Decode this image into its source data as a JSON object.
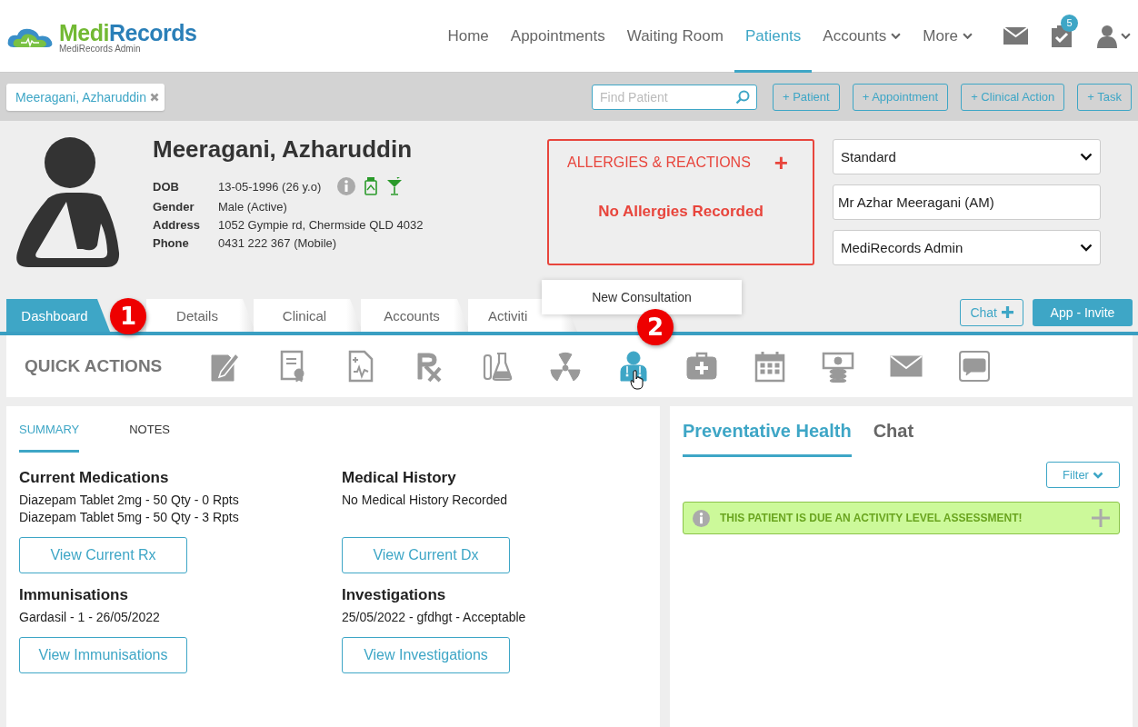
{
  "logo": {
    "first": "Medi",
    "second": "Records",
    "subtitle": "MediRecords Admin"
  },
  "nav": [
    {
      "label": "Home",
      "selected": false,
      "dropdown": false
    },
    {
      "label": "Appointments",
      "selected": false,
      "dropdown": false
    },
    {
      "label": "Waiting Room",
      "selected": false,
      "dropdown": false
    },
    {
      "label": "Patients",
      "selected": true,
      "dropdown": false
    },
    {
      "label": "Accounts",
      "selected": false,
      "dropdown": true
    },
    {
      "label": "More",
      "selected": false,
      "dropdown": true
    }
  ],
  "tasks_badge": "5",
  "toolbar": {
    "patient_chip": "Meeragani, Azharuddin",
    "search": {
      "placeholder": "Find Patient"
    },
    "buttons": [
      "+ Patient",
      "+ Appointment",
      "+ Clinical Action",
      "+ Task"
    ]
  },
  "patient": {
    "name": "Meeragani, Azharuddin",
    "fields": [
      {
        "label": "DOB",
        "value": "13-05-1996 (26 y.o)"
      },
      {
        "label": "Gender",
        "value": "Male (Active)"
      },
      {
        "label": "Address",
        "value": "1052 Gympie rd, Chermside QLD 4032"
      },
      {
        "label": "Phone",
        "value": "0431 222 367 (Mobile)"
      }
    ]
  },
  "allergies": {
    "title": "ALLERGIES & REACTIONS",
    "add": "+",
    "message": "No Allergies Recorded"
  },
  "side_fields": [
    {
      "kind": "select",
      "value": "Standard"
    },
    {
      "kind": "text",
      "value": "Mr Azhar Meeragani (AM)"
    },
    {
      "kind": "select",
      "value": "MediRecords Admin"
    }
  ],
  "tabs": [
    {
      "label": "Dashboard",
      "selected": true
    },
    {
      "label": "Details",
      "selected": false
    },
    {
      "label": "Clinical",
      "selected": false
    },
    {
      "label": "Accounts",
      "selected": false
    },
    {
      "label": "Activiti",
      "selected": false
    }
  ],
  "tooltip": "New Consultation",
  "callouts": [
    "1",
    "2"
  ],
  "chat_button": "Chat",
  "invite_button": "App - Invite",
  "quick_actions": {
    "title": "QUICK ACTIONS",
    "items": [
      {
        "kind": "note",
        "active": false
      },
      {
        "kind": "certificate",
        "active": false
      },
      {
        "kind": "report",
        "active": false
      },
      {
        "kind": "rx",
        "active": false
      },
      {
        "kind": "lab",
        "active": false
      },
      {
        "kind": "radiation",
        "active": false
      },
      {
        "kind": "doctor",
        "active": true
      },
      {
        "kind": "medkit",
        "active": false
      },
      {
        "kind": "calendar",
        "active": false
      },
      {
        "kind": "money",
        "active": false
      },
      {
        "kind": "mail",
        "active": false
      },
      {
        "kind": "sms",
        "active": false
      }
    ]
  },
  "summary": {
    "tabs": [
      {
        "label": "SUMMARY",
        "selected": true
      },
      {
        "label": "NOTES",
        "selected": false
      }
    ],
    "sections": [
      {
        "title": "Current Medications",
        "lines": [
          "Diazepam Tablet 2mg - 50 Qty - 0 Rpts",
          "Diazepam Tablet 5mg - 50 Qty - 3 Rpts"
        ],
        "button": "View Current Rx"
      },
      {
        "title": "Medical History",
        "lines": [
          "No Medical History Recorded"
        ],
        "button": "View Current Dx"
      },
      {
        "title": "Immunisations",
        "lines": [
          "Gardasil - 1 - 26/05/2022"
        ],
        "button": "View Immunisations"
      },
      {
        "title": "Investigations",
        "lines": [
          "25/05/2022 - gfdhgt - Acceptable"
        ],
        "button": "View Investigations"
      }
    ]
  },
  "health": {
    "tabs": [
      {
        "label": "Preventative Health",
        "selected": true
      },
      {
        "label": "Chat",
        "selected": false
      }
    ],
    "filter": "Filter",
    "alert": "THIS PATIENT IS DUE AN ACTIVITY LEVEL ASSESSMENT!"
  }
}
